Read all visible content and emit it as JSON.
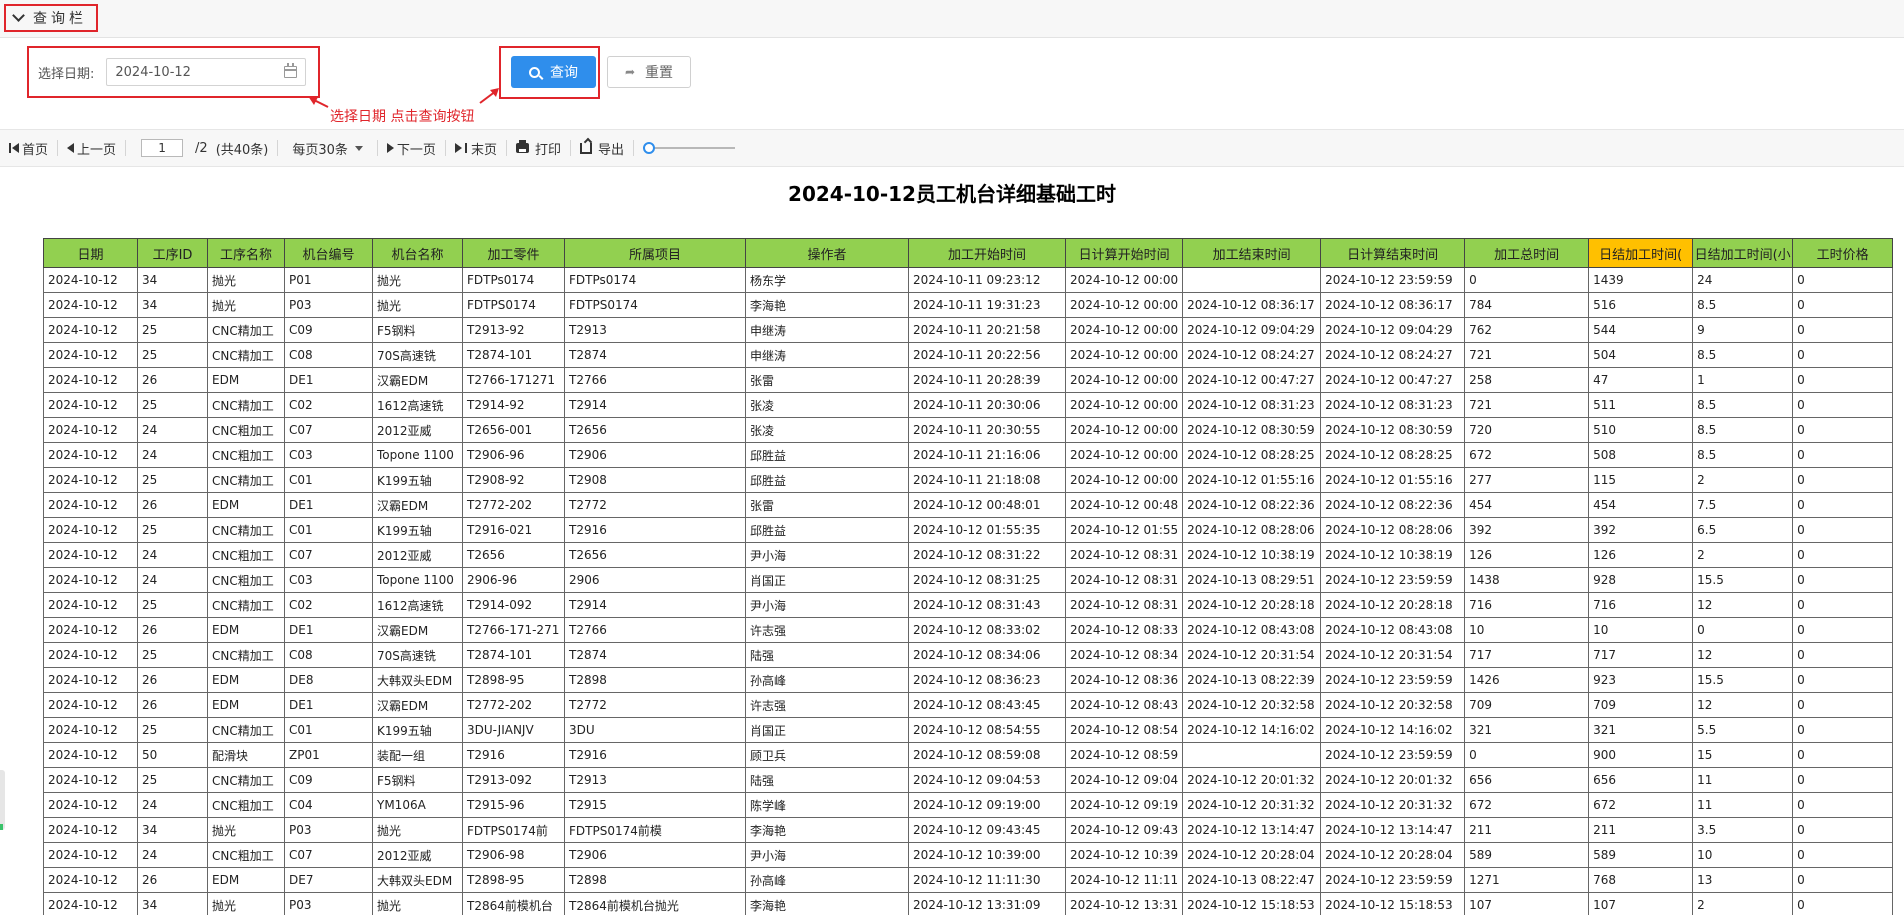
{
  "query_bar": {
    "title": "查询栏",
    "date_label": "选择日期:",
    "date_value": "2024-10-12",
    "query_button": "查询",
    "reset_button": "重置",
    "annotation": "选择日期 点击查询按钮"
  },
  "toolbar": {
    "first": "首页",
    "prev": "上一页",
    "page_current": "1",
    "page_total": "/2",
    "record_total": "(共40条)",
    "page_size": "每页30条",
    "next": "下一页",
    "last": "末页",
    "print": "打印",
    "export": "导出"
  },
  "report": {
    "title": "2024-10-12员工机台详细基础工时",
    "columns": [
      "日期",
      "工序ID",
      "工序名称",
      "机台编号",
      "机台名称",
      "加工零件",
      "所属项目",
      "操作者",
      "加工开始时间",
      "日计算开始时间",
      "加工结束时间",
      "日计算结束时间",
      "加工总时间",
      "日结加工时间(",
      "日结加工时间(小",
      "工时价格"
    ],
    "rows": [
      [
        "2024-10-12",
        "34",
        "抛光",
        "P01",
        "抛光",
        "FDTPs0174",
        "FDTPs0174",
        "杨东学",
        "2024-10-11 09:23:12",
        "2024-10-12 00:00",
        "",
        "2024-10-12 23:59:59",
        "0",
        "1439",
        "24",
        "0"
      ],
      [
        "2024-10-12",
        "34",
        "抛光",
        "P03",
        "抛光",
        "FDTPS0174",
        "FDTPS0174",
        "李海艳",
        "2024-10-11 19:31:23",
        "2024-10-12 00:00",
        "2024-10-12 08:36:17",
        "2024-10-12 08:36:17",
        "784",
        "516",
        "8.5",
        "0"
      ],
      [
        "2024-10-12",
        "25",
        "CNC精加工",
        "C09",
        "F5钢料",
        "T2913-92",
        "T2913",
        "申继涛",
        "2024-10-11 20:21:58",
        "2024-10-12 00:00",
        "2024-10-12 09:04:29",
        "2024-10-12 09:04:29",
        "762",
        "544",
        "9",
        "0"
      ],
      [
        "2024-10-12",
        "25",
        "CNC精加工",
        "C08",
        "70S高速铣",
        "T2874-101",
        "T2874",
        "申继涛",
        "2024-10-11 20:22:56",
        "2024-10-12 00:00",
        "2024-10-12 08:24:27",
        "2024-10-12 08:24:27",
        "721",
        "504",
        "8.5",
        "0"
      ],
      [
        "2024-10-12",
        "26",
        "EDM",
        "DE1",
        "汉霸EDM",
        "T2766-171271",
        "T2766",
        "张雷",
        "2024-10-11 20:28:39",
        "2024-10-12 00:00",
        "2024-10-12 00:47:27",
        "2024-10-12 00:47:27",
        "258",
        "47",
        "1",
        "0"
      ],
      [
        "2024-10-12",
        "25",
        "CNC精加工",
        "C02",
        "1612高速铣",
        "T2914-92",
        "T2914",
        "张凌",
        "2024-10-11 20:30:06",
        "2024-10-12 00:00",
        "2024-10-12 08:31:23",
        "2024-10-12 08:31:23",
        "721",
        "511",
        "8.5",
        "0"
      ],
      [
        "2024-10-12",
        "24",
        "CNC粗加工",
        "C07",
        "2012亚威",
        "T2656-001",
        "T2656",
        "张凌",
        "2024-10-11 20:30:55",
        "2024-10-12 00:00",
        "2024-10-12 08:30:59",
        "2024-10-12 08:30:59",
        "720",
        "510",
        "8.5",
        "0"
      ],
      [
        "2024-10-12",
        "24",
        "CNC粗加工",
        "C03",
        "Topone 1100",
        "T2906-96",
        "T2906",
        "邱胜益",
        "2024-10-11 21:16:06",
        "2024-10-12 00:00",
        "2024-10-12 08:28:25",
        "2024-10-12 08:28:25",
        "672",
        "508",
        "8.5",
        "0"
      ],
      [
        "2024-10-12",
        "25",
        "CNC精加工",
        "C01",
        "K199五轴",
        "T2908-92",
        "T2908",
        "邱胜益",
        "2024-10-11 21:18:08",
        "2024-10-12 00:00",
        "2024-10-12 01:55:16",
        "2024-10-12 01:55:16",
        "277",
        "115",
        "2",
        "0"
      ],
      [
        "2024-10-12",
        "26",
        "EDM",
        "DE1",
        "汉霸EDM",
        "T2772-202",
        "T2772",
        "张雷",
        "2024-10-12 00:48:01",
        "2024-10-12 00:48",
        "2024-10-12 08:22:36",
        "2024-10-12 08:22:36",
        "454",
        "454",
        "7.5",
        "0"
      ],
      [
        "2024-10-12",
        "25",
        "CNC精加工",
        "C01",
        "K199五轴",
        "T2916-021",
        "T2916",
        "邱胜益",
        "2024-10-12 01:55:35",
        "2024-10-12 01:55",
        "2024-10-12 08:28:06",
        "2024-10-12 08:28:06",
        "392",
        "392",
        "6.5",
        "0"
      ],
      [
        "2024-10-12",
        "24",
        "CNC粗加工",
        "C07",
        "2012亚威",
        "T2656",
        "T2656",
        "尹小海",
        "2024-10-12 08:31:22",
        "2024-10-12 08:31",
        "2024-10-12 10:38:19",
        "2024-10-12 10:38:19",
        "126",
        "126",
        "2",
        "0"
      ],
      [
        "2024-10-12",
        "24",
        "CNC粗加工",
        "C03",
        "Topone 1100",
        "2906-96",
        "2906",
        "肖国正",
        "2024-10-12 08:31:25",
        "2024-10-12 08:31",
        "2024-10-13 08:29:51",
        "2024-10-12 23:59:59",
        "1438",
        "928",
        "15.5",
        "0"
      ],
      [
        "2024-10-12",
        "25",
        "CNC精加工",
        "C02",
        "1612高速铣",
        "T2914-092",
        "T2914",
        "尹小海",
        "2024-10-12 08:31:43",
        "2024-10-12 08:31",
        "2024-10-12 20:28:18",
        "2024-10-12 20:28:18",
        "716",
        "716",
        "12",
        "0"
      ],
      [
        "2024-10-12",
        "26",
        "EDM",
        "DE1",
        "汉霸EDM",
        "T2766-171-271",
        "T2766",
        "许志强",
        "2024-10-12 08:33:02",
        "2024-10-12 08:33",
        "2024-10-12 08:43:08",
        "2024-10-12 08:43:08",
        "10",
        "10",
        "0",
        "0"
      ],
      [
        "2024-10-12",
        "25",
        "CNC精加工",
        "C08",
        "70S高速铣",
        "T2874-101",
        "T2874",
        "陆强",
        "2024-10-12 08:34:06",
        "2024-10-12 08:34",
        "2024-10-12 20:31:54",
        "2024-10-12 20:31:54",
        "717",
        "717",
        "12",
        "0"
      ],
      [
        "2024-10-12",
        "26",
        "EDM",
        "DE8",
        "大韩双头EDM",
        "T2898-95",
        "T2898",
        "孙高峰",
        "2024-10-12 08:36:23",
        "2024-10-12 08:36",
        "2024-10-13 08:22:39",
        "2024-10-12 23:59:59",
        "1426",
        "923",
        "15.5",
        "0"
      ],
      [
        "2024-10-12",
        "26",
        "EDM",
        "DE1",
        "汉霸EDM",
        "T2772-202",
        "T2772",
        "许志强",
        "2024-10-12 08:43:45",
        "2024-10-12 08:43",
        "2024-10-12 20:32:58",
        "2024-10-12 20:32:58",
        "709",
        "709",
        "12",
        "0"
      ],
      [
        "2024-10-12",
        "25",
        "CNC精加工",
        "C01",
        "K199五轴",
        "3DU-JIANJV",
        "3DU",
        "肖国正",
        "2024-10-12 08:54:55",
        "2024-10-12 08:54",
        "2024-10-12 14:16:02",
        "2024-10-12 14:16:02",
        "321",
        "321",
        "5.5",
        "0"
      ],
      [
        "2024-10-12",
        "50",
        "配滑块",
        "ZP01",
        "装配一组",
        "T2916",
        "T2916",
        "顾卫兵",
        "2024-10-12 08:59:08",
        "2024-10-12 08:59",
        "",
        "2024-10-12 23:59:59",
        "0",
        "900",
        "15",
        "0"
      ],
      [
        "2024-10-12",
        "25",
        "CNC精加工",
        "C09",
        "F5钢料",
        "T2913-092",
        "T2913",
        "陆强",
        "2024-10-12 09:04:53",
        "2024-10-12 09:04",
        "2024-10-12 20:01:32",
        "2024-10-12 20:01:32",
        "656",
        "656",
        "11",
        "0"
      ],
      [
        "2024-10-12",
        "24",
        "CNC粗加工",
        "C04",
        "YM106A",
        "T2915-96",
        "T2915",
        "陈学峰",
        "2024-10-12 09:19:00",
        "2024-10-12 09:19",
        "2024-10-12 20:31:32",
        "2024-10-12 20:31:32",
        "672",
        "672",
        "11",
        "0"
      ],
      [
        "2024-10-12",
        "34",
        "抛光",
        "P03",
        "抛光",
        "FDTPS0174前",
        "FDTPS0174前模",
        "李海艳",
        "2024-10-12 09:43:45",
        "2024-10-12 09:43",
        "2024-10-12 13:14:47",
        "2024-10-12 13:14:47",
        "211",
        "211",
        "3.5",
        "0"
      ],
      [
        "2024-10-12",
        "24",
        "CNC粗加工",
        "C07",
        "2012亚威",
        "T2906-98",
        "T2906",
        "尹小海",
        "2024-10-12 10:39:00",
        "2024-10-12 10:39",
        "2024-10-12 20:28:04",
        "2024-10-12 20:28:04",
        "589",
        "589",
        "10",
        "0"
      ],
      [
        "2024-10-12",
        "26",
        "EDM",
        "DE7",
        "大韩双头EDM",
        "T2898-95",
        "T2898",
        "孙高峰",
        "2024-10-12 11:11:30",
        "2024-10-12 11:11",
        "2024-10-13 08:22:47",
        "2024-10-12 23:59:59",
        "1271",
        "768",
        "13",
        "0"
      ],
      [
        "2024-10-12",
        "34",
        "抛光",
        "P03",
        "抛光",
        "T2864前模机台",
        "T2864前模机台抛光",
        "李海艳",
        "2024-10-12 13:31:09",
        "2024-10-12 13:31",
        "2024-10-12 15:18:53",
        "2024-10-12 15:18:53",
        "107",
        "107",
        "2",
        "0"
      ]
    ]
  }
}
